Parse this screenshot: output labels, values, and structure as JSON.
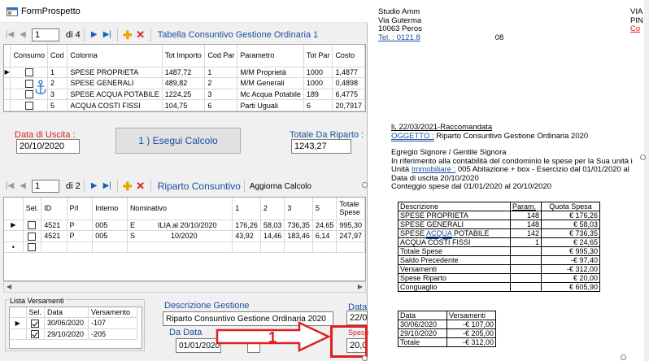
{
  "window": {
    "title": "FormProspetto"
  },
  "consuntivo": {
    "nav": {
      "position": "1",
      "of": "di 4",
      "title": "Tabella Consuntivo Gestione Ordinaria 1"
    },
    "columns": [
      "Consumo",
      "Cod",
      "Colonna",
      "Tot Importo",
      "Cod Par",
      "Parametro",
      "Tot Par",
      "Costo"
    ],
    "rows": [
      {
        "cod": "1",
        "colonna": "SPESE PROPRIETA",
        "tot": "1487,72",
        "codpar": "1",
        "param": "M/M Proprietà",
        "totpar": "1000",
        "costo": "1,4877"
      },
      {
        "cod": "2",
        "colonna": "SPESE GENERALI",
        "tot": "489,82",
        "codpar": "2",
        "param": "M/M Generali",
        "totpar": "1000",
        "costo": "0,4898"
      },
      {
        "cod": "3",
        "colonna": "SPESE ACQUA  POTABILE",
        "tot": "1224,25",
        "codpar": "3",
        "param": "Mc Acqua Potabile",
        "totpar": "189",
        "costo": "6,4775"
      },
      {
        "cod": "5",
        "colonna": "ACQUA COSTI FISSI",
        "tot": "104,75",
        "codpar": "6",
        "param": "Parti Uguali",
        "totpar": "6",
        "costo": "20,7917"
      }
    ]
  },
  "calc": {
    "date_label": "Data  di Uscita :",
    "date_value": "20/10/2020",
    "button": "1 ) Esegui Calcolo",
    "total_label": "Totale Da Riparto :",
    "total_value": "1243,27"
  },
  "riparto": {
    "nav": {
      "position": "1",
      "of": "di 2",
      "title": "Riparto Consuntivo",
      "update": "Aggiorna Calcolo"
    },
    "columns": [
      "Sel.",
      "ID",
      "P/I",
      "Interno",
      "Nominativo",
      "1",
      "2",
      "3",
      "5",
      "Totale Spese"
    ],
    "rows": [
      {
        "id": "4521",
        "pi": "P",
        "interno": "005",
        "nom1": "E",
        "nom2": "ILIA al 20/10/2020",
        "c1": "176,26",
        "c2": "58,03",
        "c3": "736,35",
        "c5": "24,65",
        "tot": "995,30"
      },
      {
        "id": "4521",
        "pi": "P",
        "interno": "005",
        "nom1": "S",
        "nom2": "10/2020",
        "c1": "43,92",
        "c2": "14,46",
        "c3": "183,46",
        "c5": "6,14",
        "tot": "247,97"
      }
    ]
  },
  "versamenti": {
    "title": "Lista Versamenti",
    "columns": [
      "Sel.",
      "Data",
      "Versamento"
    ],
    "rows": [
      {
        "data": "30/06/2020",
        "importo": "-107"
      },
      {
        "data": "29/10/2020",
        "importo": "-205"
      }
    ]
  },
  "gestione": {
    "label": "Descrizione Gestione",
    "value": "Riparto Consuntivo Gestione Ordinaria 2020",
    "dada_label": "Da Data",
    "dada_value": "01/01/2020",
    "data_label": "Data",
    "data_value": "22/0",
    "spese_label": "Spese",
    "spese_value": "20,00",
    "arrow_number": "1"
  },
  "document": {
    "header_left": [
      "Studio Amm",
      "Via Guterma",
      "10063 Peros"
    ],
    "header_left_suffix": [
      "",
      "",
      ""
    ],
    "header_left_garble": "                     ",
    "tel": "Tel. : 0121.8",
    "tel_tail": "08",
    "header_right": [
      "VIA",
      "PIN",
      "Co"
    ],
    "place_date": "li, 22/03/2021-Raccomandata",
    "oggetto_label": "OGGETTO :",
    "oggetto": "Riparto Consuntivo Gestione Ordinaria 2020",
    "salutation": "Egregio Signore / Gentile Signora",
    "body1": "In riferimento alla contabilità del condominio le spese per la Sua unità i",
    "unita_label": "Unità",
    "immobiliare": "Immobiliare :",
    "unita_value": "005 Abitazione + box  - Esercizio dal 01/01/2020 al",
    "data_uscita": "Data di uscita 20/10/2020",
    "conteggio": "Conteggio spese dal 01/01/2020 al 20/10/2020",
    "table_headers": [
      "Descrizione",
      "Param.",
      "Quota Spesa"
    ],
    "table_rows": [
      {
        "desc": "SPESE PROPRIETA",
        "param": "148",
        "quota": "€ 176,26"
      },
      {
        "desc": "SPESE GENERALI",
        "param": "148",
        "quota": "€ 58,03"
      },
      {
        "desc": "SPESE ACQUA  POTABILE",
        "param": "142",
        "quota": "€ 736,35"
      },
      {
        "desc": "ACQUA COSTI FISSI",
        "param": "1",
        "quota": "€ 24,65"
      },
      {
        "desc": "Totale Spese",
        "param": "",
        "quota": "€ 995,30"
      },
      {
        "desc": "Saldo Precedente",
        "param": "",
        "quota": "-€ 97,40"
      },
      {
        "desc": "Versamenti",
        "param": "",
        "quota": "-€ 312,00"
      },
      {
        "desc": "Spese Riparto",
        "param": "",
        "quota": "€ 20,00"
      },
      {
        "desc": "Conguaglio",
        "param": "",
        "quota": "€ 605,90"
      }
    ],
    "vers_headers": [
      "Data",
      "Versamenti"
    ],
    "vers_rows": [
      {
        "data": "30/06/2020",
        "v": "-€ 107,00"
      },
      {
        "data": "29/10/2020",
        "v": "-€ 205,00"
      },
      {
        "data": "Totale",
        "v": "-€ 312,00"
      }
    ]
  },
  "colors": {
    "accent_blue": "#1a4fa0",
    "red": "#d92020",
    "highlight": "#e02020"
  }
}
